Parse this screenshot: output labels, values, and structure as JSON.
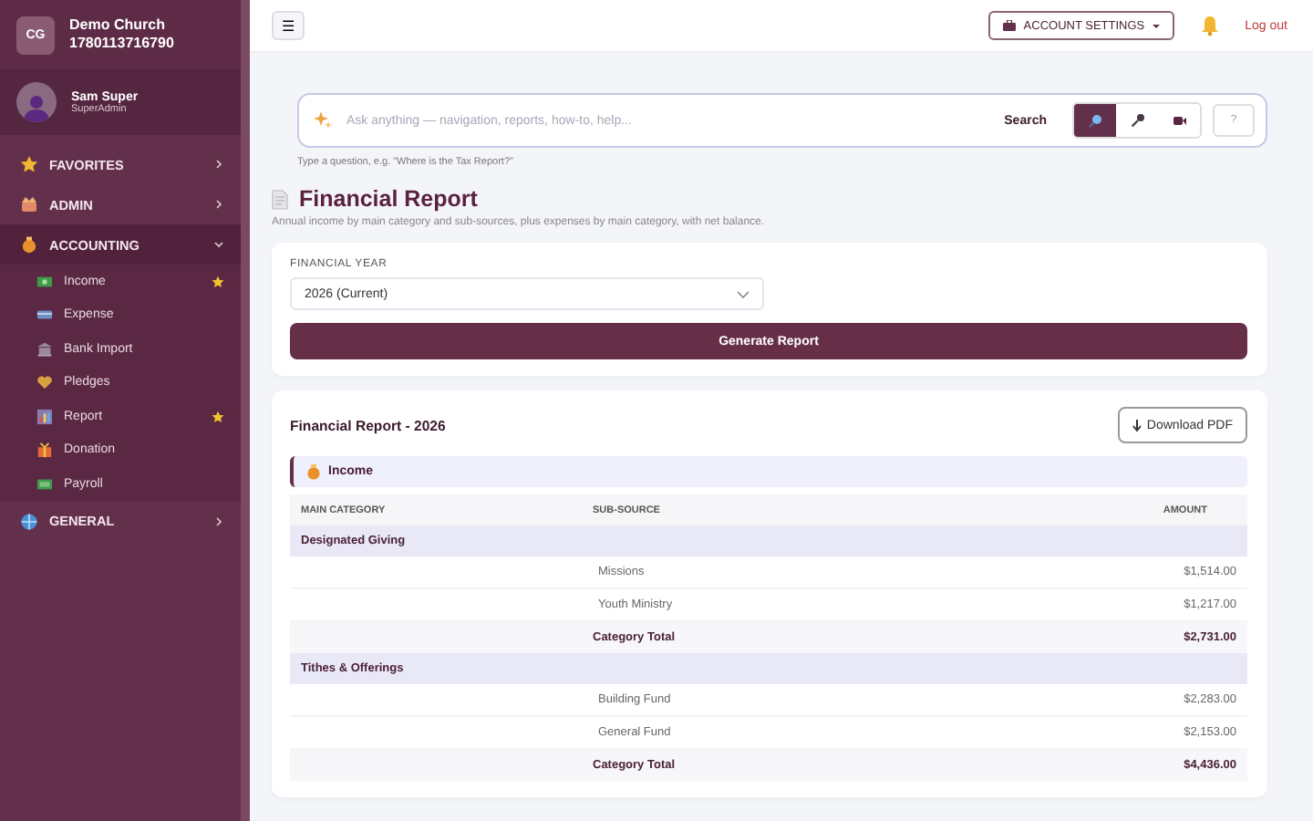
{
  "org": {
    "initials": "CG",
    "name": "Demo Church",
    "code": "1780113716790"
  },
  "user": {
    "name": "Sam Super",
    "role": "SuperAdmin"
  },
  "nav": [
    {
      "label": "FAVORITES",
      "expanded": false
    },
    {
      "label": "ADMIN",
      "expanded": false
    },
    {
      "label": "ACCOUNTING",
      "expanded": true,
      "children": [
        {
          "label": "Income",
          "favorite": true
        },
        {
          "label": "Expense",
          "favorite": false
        },
        {
          "label": "Bank Import",
          "favorite": false
        },
        {
          "label": "Pledges",
          "favorite": false
        },
        {
          "label": "Report",
          "favorite": true
        },
        {
          "label": "Donation",
          "favorite": false
        },
        {
          "label": "Payroll",
          "favorite": false
        }
      ]
    },
    {
      "label": "GENERAL",
      "expanded": false
    }
  ],
  "topbar": {
    "menu_glyph": "☰",
    "account_settings": "ACCOUNT SETTINGS",
    "logout": "Log out"
  },
  "search": {
    "placeholder": "Ask anything — navigation, reports, how-to, help...",
    "button": "Search",
    "modes": [
      {
        "selected": true
      },
      {
        "selected": false
      },
      {
        "selected": false
      }
    ],
    "help": "?",
    "hint": "Type a question, e.g. \"Where is the Tax Report?\""
  },
  "page": {
    "title": "Financial Report",
    "subtitle": "Annual income by main category and sub-sources, plus expenses by main category, with net balance."
  },
  "form": {
    "label": "FINANCIAL YEAR",
    "year": "2026 (Current)",
    "generate": "Generate Report"
  },
  "report": {
    "title": "Financial Report - 2026",
    "download": "Download PDF",
    "section": "Income",
    "columns": [
      "MAIN CATEGORY",
      "SUB-SOURCE",
      "AMOUNT"
    ],
    "rows": [
      {
        "kind": "group",
        "category": "Designated Giving"
      },
      {
        "kind": "item",
        "source": "Missions",
        "amount": "$1,514.00"
      },
      {
        "kind": "item",
        "source": "Youth Ministry",
        "amount": "$1,217.00"
      },
      {
        "kind": "total",
        "source": "Category Total",
        "amount": "$2,731.00"
      },
      {
        "kind": "group",
        "category": "Tithes & Offerings"
      },
      {
        "kind": "item",
        "source": "Building Fund",
        "amount": "$2,283.00"
      },
      {
        "kind": "item",
        "source": "General Fund",
        "amount": "$2,153.00"
      },
      {
        "kind": "total",
        "source": "Category Total",
        "amount": "$4,436.00"
      }
    ]
  }
}
